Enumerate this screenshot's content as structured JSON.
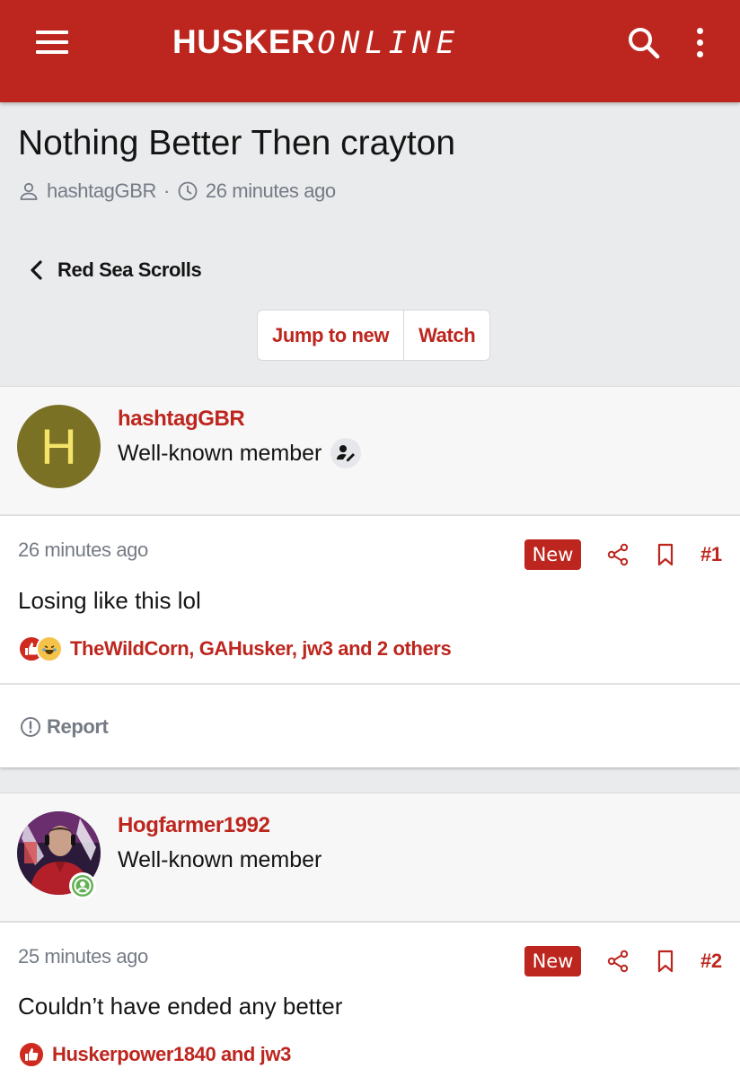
{
  "header": {
    "brand_bold": "HUSKER",
    "brand_light": "ONLINE",
    "brand_color": "#bd261e"
  },
  "thread": {
    "title": "Nothing Better Then crayton",
    "author": "hashtagGBR",
    "separator": "·",
    "posted": "26 minutes ago",
    "breadcrumb": "Red Sea Scrolls",
    "jump_label": "Jump to new",
    "watch_label": "Watch"
  },
  "posts": [
    {
      "username": "hashtagGBR",
      "avatar_letter": "H",
      "user_title": "Well-known member",
      "time": "26 minutes ago",
      "new_label": "New",
      "number": "#1",
      "body": "Losing like this lol",
      "reactions": "TheWildCorn, GAHusker, jw3 and 2 others",
      "report_label": "Report"
    },
    {
      "username": "Hogfarmer1992",
      "user_title": "Well-known member",
      "time": "25 minutes ago",
      "new_label": "New",
      "number": "#2",
      "body": "Couldn’t have ended any better",
      "reactions": "Huskerpower1840 and jw3"
    }
  ],
  "icons": {
    "menu": "hamburger-icon",
    "search": "search-icon",
    "more": "kebab-icon",
    "user": "user-icon",
    "clock": "clock-icon",
    "back": "chevron-left-icon",
    "share": "share-icon",
    "bookmark": "bookmark-icon",
    "like": "like-reaction-icon",
    "laugh": "laugh-reaction-icon",
    "report": "alert-circle-icon"
  }
}
